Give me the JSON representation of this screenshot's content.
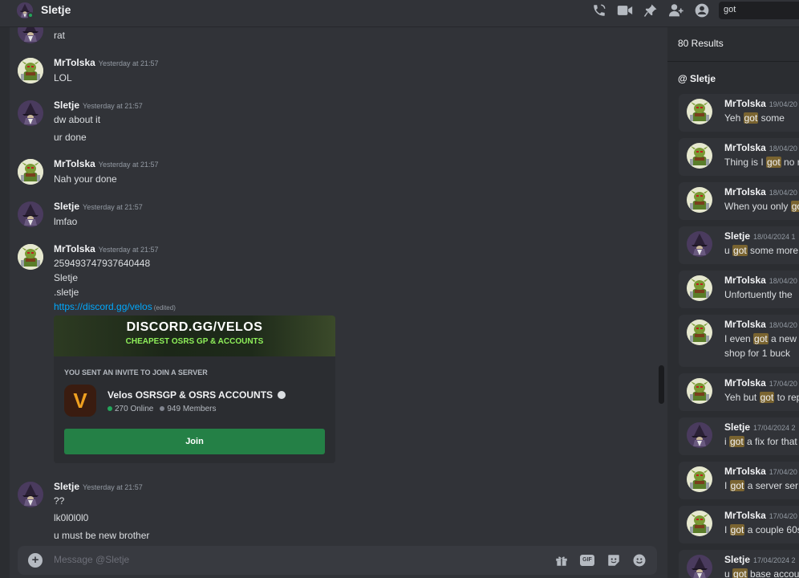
{
  "header": {
    "title": "Sletje",
    "search_value": "got"
  },
  "messages": [
    {
      "kind": "cont",
      "lines": [
        "rat"
      ]
    },
    {
      "author": "MrTolska",
      "time": "Yesterday at 21:57",
      "lines": [
        "LOL"
      ]
    },
    {
      "author": "Sletje",
      "time": "Yesterday at 21:57",
      "lines": [
        "dw about it",
        "ur done"
      ]
    },
    {
      "author": "MrTolska",
      "time": "Yesterday at 21:57",
      "lines": [
        "Nah your done"
      ]
    },
    {
      "author": "Sletje",
      "time": "Yesterday at 21:57",
      "lines": [
        "lmfao"
      ]
    },
    {
      "author": "MrTolska",
      "time": "Yesterday at 21:57",
      "lines": [
        "259493747937640448",
        "Sletje",
        ".sletje"
      ],
      "link": "https://discord.gg/velos",
      "edited": "(edited)"
    },
    {
      "author": "Sletje",
      "time": "Yesterday at 21:57",
      "lines": [
        "??",
        "lk0l0l0l0",
        "u must be new brother"
      ]
    }
  ],
  "invite": {
    "banner_title": "DISCORD.GG/VELOS",
    "banner_subtitle": "CHEAPEST OSRS GP & ACCOUNTS",
    "label": "YOU SENT AN INVITE TO JOIN A SERVER",
    "guild_name": "Velos OSRSGP & OSRS ACCOUNTS",
    "guild_icon_letter": "V",
    "online": "270 Online",
    "members": "949 Members",
    "join_label": "Join"
  },
  "composer": {
    "placeholder": "Message @Sletje",
    "gif_label": "GIF"
  },
  "search_results": {
    "count": "80 Results",
    "channel": "@ Sletje",
    "items": [
      {
        "author": "MrTolska",
        "date": "19/04/20",
        "pre": "Yeh ",
        "hl": "got",
        "post": " some",
        "line2": ""
      },
      {
        "author": "MrTolska",
        "date": "18/04/20",
        "pre": "Thing is I ",
        "hl": "got",
        "post": " no r",
        "line2": ""
      },
      {
        "author": "MrTolska",
        "date": "18/04/20",
        "pre": "When you only ",
        "hl": "go",
        "post": "",
        "line2": ""
      },
      {
        "author": "Sletje",
        "date": "18/04/2024 1",
        "pre": "u ",
        "hl": "got",
        "post": " some more",
        "line2": ""
      },
      {
        "author": "MrTolska",
        "date": "18/04/20",
        "pre": "Unfortuently the",
        "hl": "",
        "post": "",
        "line2": ""
      },
      {
        "author": "MrTolska",
        "date": "18/04/20",
        "pre": "I even ",
        "hl": "got",
        "post": " a new s",
        "line2": "shop for 1 buck"
      },
      {
        "author": "MrTolska",
        "date": "17/04/20",
        "pre": "Yeh but ",
        "hl": "got",
        "post": " to rep",
        "line2": ""
      },
      {
        "author": "Sletje",
        "date": "17/04/2024 2",
        "pre": "i ",
        "hl": "got",
        "post": " a fix for that",
        "line2": ""
      },
      {
        "author": "MrTolska",
        "date": "17/04/20",
        "pre": "I ",
        "hl": "got",
        "post": " a server ser",
        "line2": ""
      },
      {
        "author": "MrTolska",
        "date": "17/04/20",
        "pre": "I ",
        "hl": "got",
        "post": " a couple 60s",
        "line2": ""
      },
      {
        "author": "Sletje",
        "date": "17/04/2024 2",
        "pre": "u ",
        "hl": "got",
        "post": " base accou",
        "line2": ""
      }
    ]
  },
  "colors": {
    "background": "#313338",
    "sidebar": "#2b2d31",
    "link": "#00a8fc",
    "join_button": "#248046",
    "online": "#23a55a",
    "highlight": "#7a6430"
  },
  "icons": [
    "phone-call-icon",
    "video-camera-icon",
    "pin-icon",
    "add-friend-icon",
    "profile-icon",
    "plus-icon",
    "gift-icon",
    "gif-icon",
    "sticker-icon",
    "emoji-icon"
  ]
}
